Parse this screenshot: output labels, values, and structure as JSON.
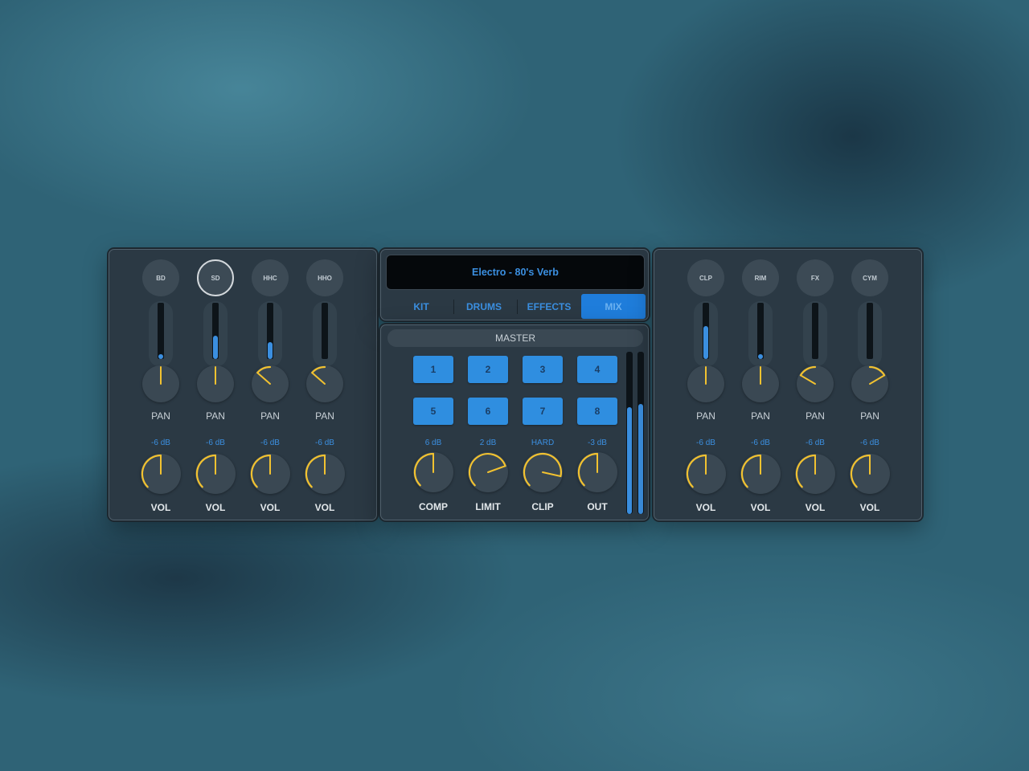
{
  "left_channels": [
    {
      "name": "BD",
      "selected": false,
      "meter_level": 0.08,
      "pan_label": "PAN",
      "pan_value": 0.5,
      "vol_db": "-6 dB",
      "vol_label": "VOL",
      "vol_value": 0.5
    },
    {
      "name": "SD",
      "selected": true,
      "meter_level": 0.42,
      "pan_label": "PAN",
      "pan_value": 0.5,
      "vol_db": "-6 dB",
      "vol_label": "VOL",
      "vol_value": 0.5
    },
    {
      "name": "HHC",
      "selected": false,
      "meter_level": 0.3,
      "pan_label": "PAN",
      "pan_value": 0.32,
      "vol_db": "-6 dB",
      "vol_label": "VOL",
      "vol_value": 0.5
    },
    {
      "name": "HHO",
      "selected": false,
      "meter_level": 0.0,
      "pan_label": "PAN",
      "pan_value": 0.32,
      "vol_db": "-6 dB",
      "vol_label": "VOL",
      "vol_value": 0.5
    }
  ],
  "right_channels": [
    {
      "name": "CLP",
      "selected": false,
      "meter_level": 0.58,
      "pan_label": "PAN",
      "pan_value": 0.5,
      "vol_db": "-6 dB",
      "vol_label": "VOL",
      "vol_value": 0.5
    },
    {
      "name": "RIM",
      "selected": false,
      "meter_level": 0.08,
      "pan_label": "PAN",
      "pan_value": 0.5,
      "vol_db": "-6 dB",
      "vol_label": "VOL",
      "vol_value": 0.5
    },
    {
      "name": "FX",
      "selected": false,
      "meter_level": 0.0,
      "pan_label": "PAN",
      "pan_value": 0.28,
      "vol_db": "-6 dB",
      "vol_label": "VOL",
      "vol_value": 0.5
    },
    {
      "name": "CYM",
      "selected": false,
      "meter_level": 0.0,
      "pan_label": "PAN",
      "pan_value": 0.72,
      "vol_db": "-6 dB",
      "vol_label": "VOL",
      "vol_value": 0.5
    }
  ],
  "preset": {
    "name": "Electro - 80's Verb"
  },
  "tabs": [
    {
      "label": "KIT",
      "active": false
    },
    {
      "label": "DRUMS",
      "active": false
    },
    {
      "label": "EFFECTS",
      "active": false
    },
    {
      "label": "MIX",
      "active": true
    }
  ],
  "master": {
    "title": "MASTER",
    "pads": [
      "1",
      "2",
      "3",
      "4",
      "5",
      "6",
      "7",
      "8"
    ],
    "knobs": [
      {
        "value_label": "6 dB",
        "label": "COMP",
        "value": 0.5
      },
      {
        "value_label": "2 dB",
        "label": "LIMIT",
        "value": 0.76
      },
      {
        "value_label": "HARD",
        "label": "CLIP",
        "value": 0.88
      },
      {
        "value_label": "-3 dB",
        "label": "OUT",
        "value": 0.5
      }
    ],
    "output_meters": [
      0.66,
      0.68
    ]
  },
  "colors": {
    "accent": "#3b8fe0",
    "knob_arc": "#f2c230",
    "pad": "#2f8ee0",
    "panel": "#2b3944"
  }
}
